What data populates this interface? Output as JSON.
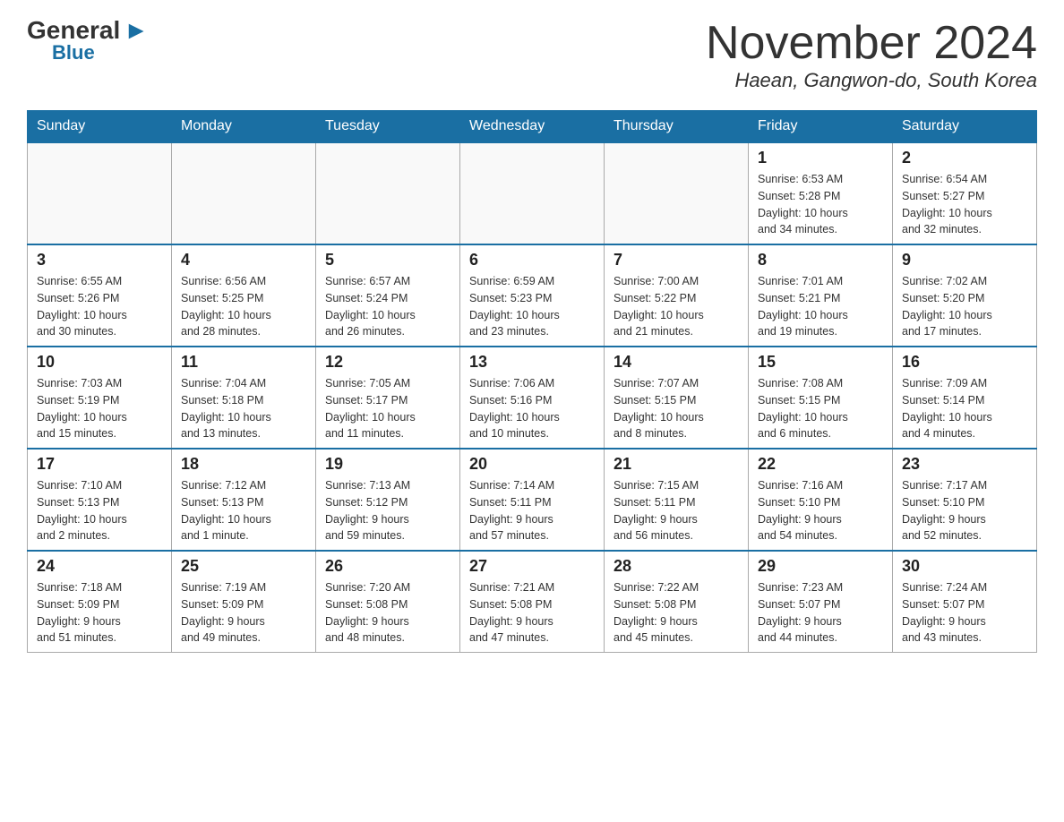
{
  "logo": {
    "general_text": "General",
    "blue_text": "Blue"
  },
  "title": {
    "month_year": "November 2024",
    "location": "Haean, Gangwon-do, South Korea"
  },
  "days_of_week": [
    "Sunday",
    "Monday",
    "Tuesday",
    "Wednesday",
    "Thursday",
    "Friday",
    "Saturday"
  ],
  "weeks": [
    [
      {
        "day": "",
        "info": ""
      },
      {
        "day": "",
        "info": ""
      },
      {
        "day": "",
        "info": ""
      },
      {
        "day": "",
        "info": ""
      },
      {
        "day": "",
        "info": ""
      },
      {
        "day": "1",
        "info": "Sunrise: 6:53 AM\nSunset: 5:28 PM\nDaylight: 10 hours\nand 34 minutes."
      },
      {
        "day": "2",
        "info": "Sunrise: 6:54 AM\nSunset: 5:27 PM\nDaylight: 10 hours\nand 32 minutes."
      }
    ],
    [
      {
        "day": "3",
        "info": "Sunrise: 6:55 AM\nSunset: 5:26 PM\nDaylight: 10 hours\nand 30 minutes."
      },
      {
        "day": "4",
        "info": "Sunrise: 6:56 AM\nSunset: 5:25 PM\nDaylight: 10 hours\nand 28 minutes."
      },
      {
        "day": "5",
        "info": "Sunrise: 6:57 AM\nSunset: 5:24 PM\nDaylight: 10 hours\nand 26 minutes."
      },
      {
        "day": "6",
        "info": "Sunrise: 6:59 AM\nSunset: 5:23 PM\nDaylight: 10 hours\nand 23 minutes."
      },
      {
        "day": "7",
        "info": "Sunrise: 7:00 AM\nSunset: 5:22 PM\nDaylight: 10 hours\nand 21 minutes."
      },
      {
        "day": "8",
        "info": "Sunrise: 7:01 AM\nSunset: 5:21 PM\nDaylight: 10 hours\nand 19 minutes."
      },
      {
        "day": "9",
        "info": "Sunrise: 7:02 AM\nSunset: 5:20 PM\nDaylight: 10 hours\nand 17 minutes."
      }
    ],
    [
      {
        "day": "10",
        "info": "Sunrise: 7:03 AM\nSunset: 5:19 PM\nDaylight: 10 hours\nand 15 minutes."
      },
      {
        "day": "11",
        "info": "Sunrise: 7:04 AM\nSunset: 5:18 PM\nDaylight: 10 hours\nand 13 minutes."
      },
      {
        "day": "12",
        "info": "Sunrise: 7:05 AM\nSunset: 5:17 PM\nDaylight: 10 hours\nand 11 minutes."
      },
      {
        "day": "13",
        "info": "Sunrise: 7:06 AM\nSunset: 5:16 PM\nDaylight: 10 hours\nand 10 minutes."
      },
      {
        "day": "14",
        "info": "Sunrise: 7:07 AM\nSunset: 5:15 PM\nDaylight: 10 hours\nand 8 minutes."
      },
      {
        "day": "15",
        "info": "Sunrise: 7:08 AM\nSunset: 5:15 PM\nDaylight: 10 hours\nand 6 minutes."
      },
      {
        "day": "16",
        "info": "Sunrise: 7:09 AM\nSunset: 5:14 PM\nDaylight: 10 hours\nand 4 minutes."
      }
    ],
    [
      {
        "day": "17",
        "info": "Sunrise: 7:10 AM\nSunset: 5:13 PM\nDaylight: 10 hours\nand 2 minutes."
      },
      {
        "day": "18",
        "info": "Sunrise: 7:12 AM\nSunset: 5:13 PM\nDaylight: 10 hours\nand 1 minute."
      },
      {
        "day": "19",
        "info": "Sunrise: 7:13 AM\nSunset: 5:12 PM\nDaylight: 9 hours\nand 59 minutes."
      },
      {
        "day": "20",
        "info": "Sunrise: 7:14 AM\nSunset: 5:11 PM\nDaylight: 9 hours\nand 57 minutes."
      },
      {
        "day": "21",
        "info": "Sunrise: 7:15 AM\nSunset: 5:11 PM\nDaylight: 9 hours\nand 56 minutes."
      },
      {
        "day": "22",
        "info": "Sunrise: 7:16 AM\nSunset: 5:10 PM\nDaylight: 9 hours\nand 54 minutes."
      },
      {
        "day": "23",
        "info": "Sunrise: 7:17 AM\nSunset: 5:10 PM\nDaylight: 9 hours\nand 52 minutes."
      }
    ],
    [
      {
        "day": "24",
        "info": "Sunrise: 7:18 AM\nSunset: 5:09 PM\nDaylight: 9 hours\nand 51 minutes."
      },
      {
        "day": "25",
        "info": "Sunrise: 7:19 AM\nSunset: 5:09 PM\nDaylight: 9 hours\nand 49 minutes."
      },
      {
        "day": "26",
        "info": "Sunrise: 7:20 AM\nSunset: 5:08 PM\nDaylight: 9 hours\nand 48 minutes."
      },
      {
        "day": "27",
        "info": "Sunrise: 7:21 AM\nSunset: 5:08 PM\nDaylight: 9 hours\nand 47 minutes."
      },
      {
        "day": "28",
        "info": "Sunrise: 7:22 AM\nSunset: 5:08 PM\nDaylight: 9 hours\nand 45 minutes."
      },
      {
        "day": "29",
        "info": "Sunrise: 7:23 AM\nSunset: 5:07 PM\nDaylight: 9 hours\nand 44 minutes."
      },
      {
        "day": "30",
        "info": "Sunrise: 7:24 AM\nSunset: 5:07 PM\nDaylight: 9 hours\nand 43 minutes."
      }
    ]
  ]
}
